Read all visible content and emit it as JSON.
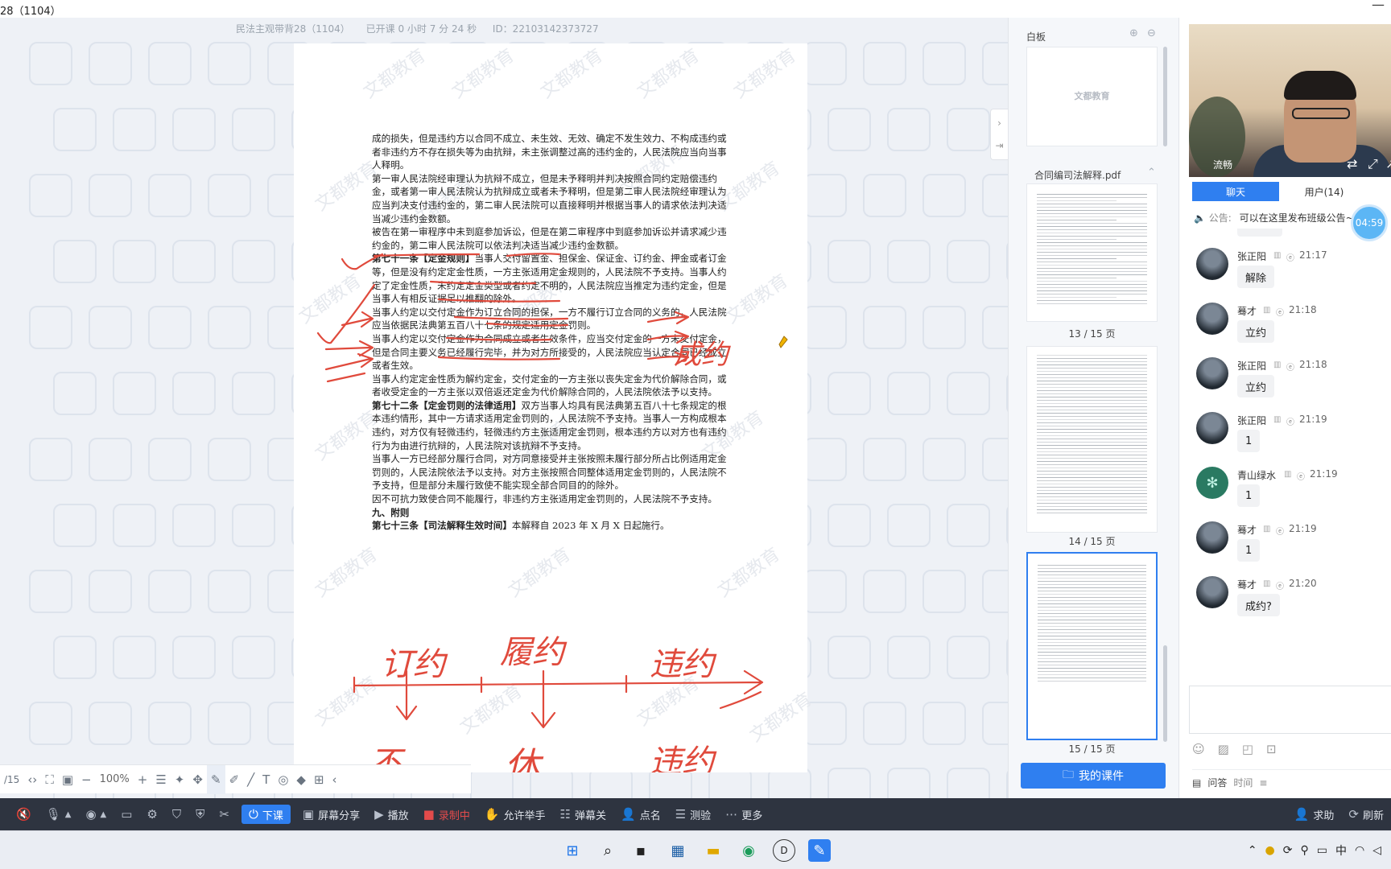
{
  "window": {
    "title": "28（1104）",
    "minimize_glyph": "—"
  },
  "class_info": {
    "name": "民法主观带背28（1104）",
    "elapsed": "已开课 0 小时 7 分 24 秒",
    "id": "ID：22103142373727"
  },
  "document": {
    "watermark": "文都教育",
    "paragraphs": [
      {
        "text": "成的损失，但是违约方以合同不成立、未生效、无效、确定不发生效力、不构成违约或者非违约方不存在损失等为由抗辩，未主张调整过高的违约金的，人民法院应当向当事人释明。",
        "bold_prefix": ""
      },
      {
        "text": "第一审人民法院经审理认为抗辩不成立，但是未予释明并判决按照合同约定赔偿违约金，或者第一审人民法院认为抗辩成立或者未予释明，但是第二审人民法院经审理认为应当判决支付违约金的，第二审人民法院可以直接释明并根据当事人的请求依法判决适当减少违约金数额。",
        "bold_prefix": ""
      },
      {
        "text": "被告在第一审程序中未到庭参加诉讼，但是在第二审程序中到庭参加诉讼并请求减少违约金的，第二审人民法院可以依法判决适当减少违约金数额。",
        "bold_prefix": ""
      },
      {
        "bold_prefix": "第七十一条【定金规则】",
        "text": "当事人交付留置金、担保金、保证金、订约金、押金或者订金等，但是没有约定定金性质，一方主张适用定金规则的，人民法院不予支持。当事人约定了定金性质，未约定定金类型或者约定不明的，人民法院应当推定为违约定金，但是当事人有相反证据足以推翻的除外。"
      },
      {
        "bold_prefix": "",
        "text": "当事人约定以交付定金作为订立合同的担保，一方不履行订立合同的义务的，人民法院应当依据民法典第五百八十七条的规定适用定金罚则。"
      },
      {
        "bold_prefix": "",
        "text": "当事人约定以交付定金作为合同成立或者生效条件，应当交付定金的一方未交付定金，但是合同主要义务已经履行完毕，并为对方所接受的，人民法院应当认定合同已经成立或者生效。"
      },
      {
        "bold_prefix": "",
        "text": "当事人约定定金性质为解约定金，交付定金的一方主张以丧失定金为代价解除合同，或者收受定金的一方主张以双倍返还定金为代价解除合同的，人民法院依法予以支持。"
      },
      {
        "bold_prefix": "第七十二条【定金罚则的法律适用】",
        "text": "双方当事人均具有民法典第五百八十七条规定的根本违约情形，其中一方请求适用定金罚则的，人民法院不予支持。当事人一方构成根本违约，对方仅有轻微违约，轻微违约方主张适用定金罚则，根本违约方以对方也有违约行为为由进行抗辩的，人民法院对该抗辩不予支持。"
      },
      {
        "bold_prefix": "",
        "text": "当事人一方已经部分履行合同，对方同意接受并主张按照未履行部分所占比例适用定金罚则的，人民法院依法予以支持。对方主张按照合同整体适用定金罚则的，人民法院不予支持，但是部分未履行致使不能实现全部合同目的的除外。"
      },
      {
        "bold_prefix": "",
        "text": "因不可抗力致使合同不能履行，非违约方主张适用定金罚则的，人民法院不予支持。"
      },
      {
        "bold_prefix": "九、附则",
        "text": ""
      },
      {
        "bold_prefix": "第七十三条【司法解释生效时间】",
        "text": "本解释自 2023 年 X 月 X 日起施行。"
      }
    ],
    "handwriting": {
      "mid": "成约",
      "top_left": "订约",
      "top_mid": "履约",
      "top_right": "违约",
      "bottom_left": "不",
      "bottom_mid": "休",
      "bottom_right": "违约"
    }
  },
  "float_toolbar": {
    "page": "/15",
    "zoom": "100%"
  },
  "slides_panel": {
    "whiteboard_label": "白板",
    "whiteboard_logo": "文都教育",
    "file_name": "合同编司法解释.pdf",
    "pages": [
      "13 / 15 页",
      "14 / 15 页",
      "15 / 15 页"
    ],
    "my_course": "我的课件"
  },
  "video": {
    "name": "流畅"
  },
  "chat": {
    "tabs": [
      "聊天",
      "用户(14)"
    ],
    "notice_label": "公告:",
    "notice_text": "可以在这里发布班级公告~",
    "timer": "04:59",
    "messages": [
      {
        "name": "张正阳",
        "time": "21:17",
        "text": "解除"
      },
      {
        "name": "蓦才",
        "time": "21:18",
        "text": "立约"
      },
      {
        "name": "张正阳",
        "time": "21:18",
        "text": "立约"
      },
      {
        "name": "张正阳",
        "time": "21:19",
        "text": "1"
      },
      {
        "name": "青山绿水",
        "time": "21:19",
        "text": "1"
      },
      {
        "name": "蓦才",
        "time": "21:19",
        "text": "1"
      },
      {
        "name": "蓦才",
        "time": "21:20",
        "text": "成约?"
      }
    ],
    "qa_label": "问答",
    "qa_sub": "时间"
  },
  "classbar": {
    "end_class": "下课",
    "screen_share": "屏幕分享",
    "play": "播放",
    "recording": "录制中",
    "allow_hands": "允许举手",
    "danmu": "弹幕关",
    "roll_call": "点名",
    "quiz": "测验",
    "more": "更多",
    "help": "求助",
    "refresh": "刷新"
  },
  "tray": {
    "ime": "中"
  },
  "colors": {
    "accent": "#2f7ff0",
    "ink": "#e04a3c",
    "toolbar": "#2e3440"
  }
}
